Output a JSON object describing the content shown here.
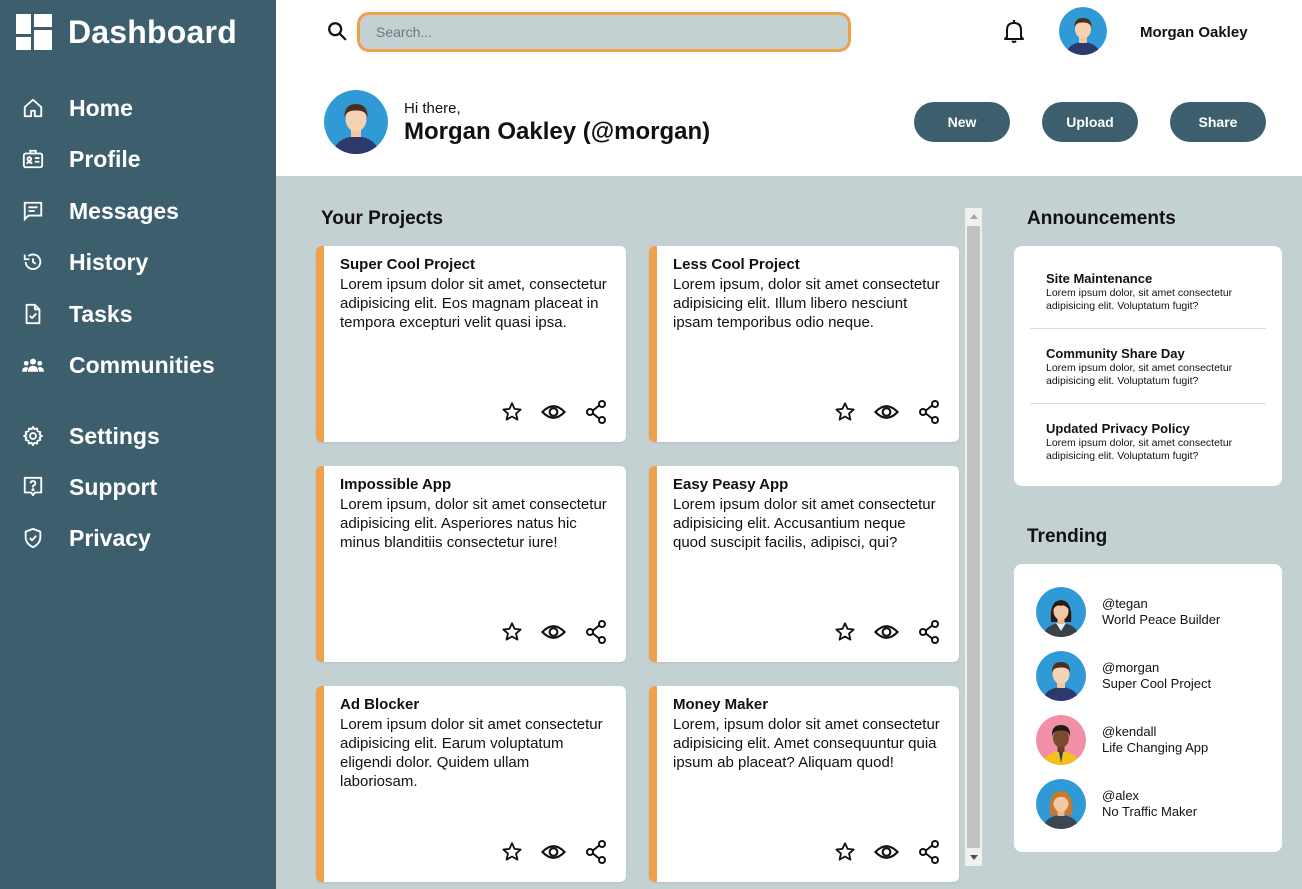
{
  "sidebar": {
    "title": "Dashboard",
    "items": [
      {
        "label": "Home",
        "icon": "home-icon"
      },
      {
        "label": "Profile",
        "icon": "profile-card-icon"
      },
      {
        "label": "Messages",
        "icon": "message-icon"
      },
      {
        "label": "History",
        "icon": "history-icon"
      },
      {
        "label": "Tasks",
        "icon": "tasks-icon"
      },
      {
        "label": "Communities",
        "icon": "communities-icon"
      },
      {
        "label": "Settings",
        "icon": "gear-icon"
      },
      {
        "label": "Support",
        "icon": "help-icon"
      },
      {
        "label": "Privacy",
        "icon": "shield-icon"
      }
    ]
  },
  "header": {
    "search": {
      "placeholder": "Search...",
      "value": ""
    },
    "username": "Morgan Oakley",
    "greeting": "Hi there,",
    "display_name": "Morgan Oakley (@morgan)",
    "buttons": {
      "new": "New",
      "upload": "Upload",
      "share": "Share"
    }
  },
  "projects": {
    "title": "Your Projects",
    "cards": [
      {
        "title": "Super Cool Project",
        "body": "Lorem ipsum dolor sit amet, consectetur adipisicing elit. Eos magnam placeat in tempora excepturi velit quasi ipsa."
      },
      {
        "title": "Less Cool Project",
        "body": "Lorem ipsum, dolor sit amet consectetur adipisicing elit. Illum libero nesciunt ipsam temporibus odio neque."
      },
      {
        "title": "Impossible App",
        "body": "Lorem ipsum, dolor sit amet consectetur adipisicing elit. Asperiores natus hic minus blanditiis consectetur iure!"
      },
      {
        "title": "Easy Peasy App",
        "body": "Lorem ipsum dolor sit amet consectetur adipisicing elit. Accusantium neque quod suscipit facilis, adipisci, qui?"
      },
      {
        "title": "Ad Blocker",
        "body": "Lorem ipsum dolor sit amet consectetur adipisicing elit. Earum voluptatum eligendi dolor. Quidem ullam laboriosam."
      },
      {
        "title": "Money Maker",
        "body": "Lorem, ipsum dolor sit amet consectetur adipisicing elit. Amet consequuntur quia ipsum ab placeat? Aliquam quod!"
      }
    ]
  },
  "announcements": {
    "title": "Announcements",
    "items": [
      {
        "title": "Site Maintenance",
        "body": "Lorem ipsum dolor, sit amet consectetur adipisicing elit. Voluptatum fugit?"
      },
      {
        "title": "Community Share Day",
        "body": "Lorem ipsum dolor, sit amet consectetur adipisicing elit. Voluptatum fugit?"
      },
      {
        "title": "Updated Privacy Policy",
        "body": "Lorem ipsum dolor, sit amet consectetur adipisicing elit. Voluptatum fugit?"
      }
    ]
  },
  "trending": {
    "title": "Trending",
    "items": [
      {
        "handle": "@tegan",
        "desc": "World Peace Builder"
      },
      {
        "handle": "@morgan",
        "desc": "Super Cool Project"
      },
      {
        "handle": "@kendall",
        "desc": "Life Changing App"
      },
      {
        "handle": "@alex",
        "desc": "No Traffic Maker"
      }
    ]
  },
  "colors": {
    "sidebar": "#3d5f6d",
    "accent": "#f0a04b",
    "background": "#c4d1d3",
    "avatar_blue": "#2f9ad6",
    "avatar_pink": "#f08fa5"
  }
}
